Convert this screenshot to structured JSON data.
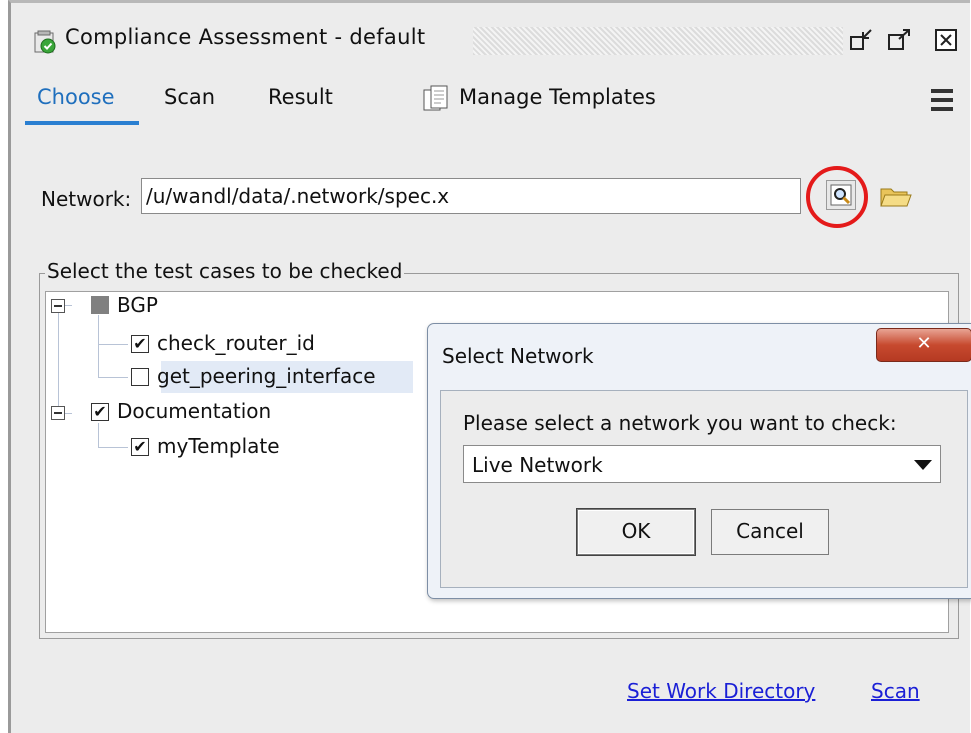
{
  "window": {
    "title": "Compliance Assessment - default"
  },
  "tabs": {
    "choose": "Choose",
    "scan": "Scan",
    "result": "Result",
    "manage_templates": "Manage Templates",
    "active": "Choose"
  },
  "network": {
    "label": "Network:",
    "value": "/u/wandl/data/.network/spec.x"
  },
  "test_cases": {
    "legend": "Select the test cases to be checked",
    "tree": [
      {
        "label": "BGP",
        "state": "partial",
        "children": [
          {
            "label": "check_router_id",
            "state": "checked"
          },
          {
            "label": "get_peering_interface",
            "state": "unchecked",
            "selected": true
          }
        ]
      },
      {
        "label": "Documentation",
        "state": "checked",
        "children": [
          {
            "label": "myTemplate",
            "state": "checked"
          }
        ]
      }
    ]
  },
  "dialog": {
    "title": "Select Network",
    "prompt": "Please select a network you want to check:",
    "selected_option": "Live Network",
    "ok_label": "OK",
    "cancel_label": "Cancel"
  },
  "footer": {
    "set_work_directory": "Set Work Directory",
    "scan": "Scan"
  },
  "colors": {
    "accent": "#2a7fd1",
    "link": "#1a1fd6",
    "highlight": "#e41a1a"
  }
}
